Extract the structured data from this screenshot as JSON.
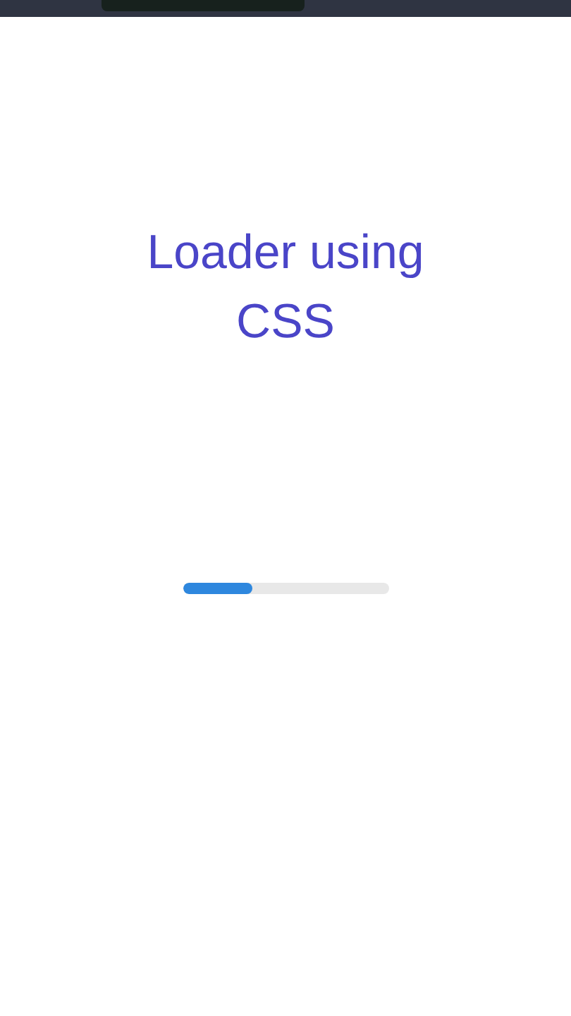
{
  "title": "Loader using CSS",
  "loader": {
    "level": 0.34
  }
}
